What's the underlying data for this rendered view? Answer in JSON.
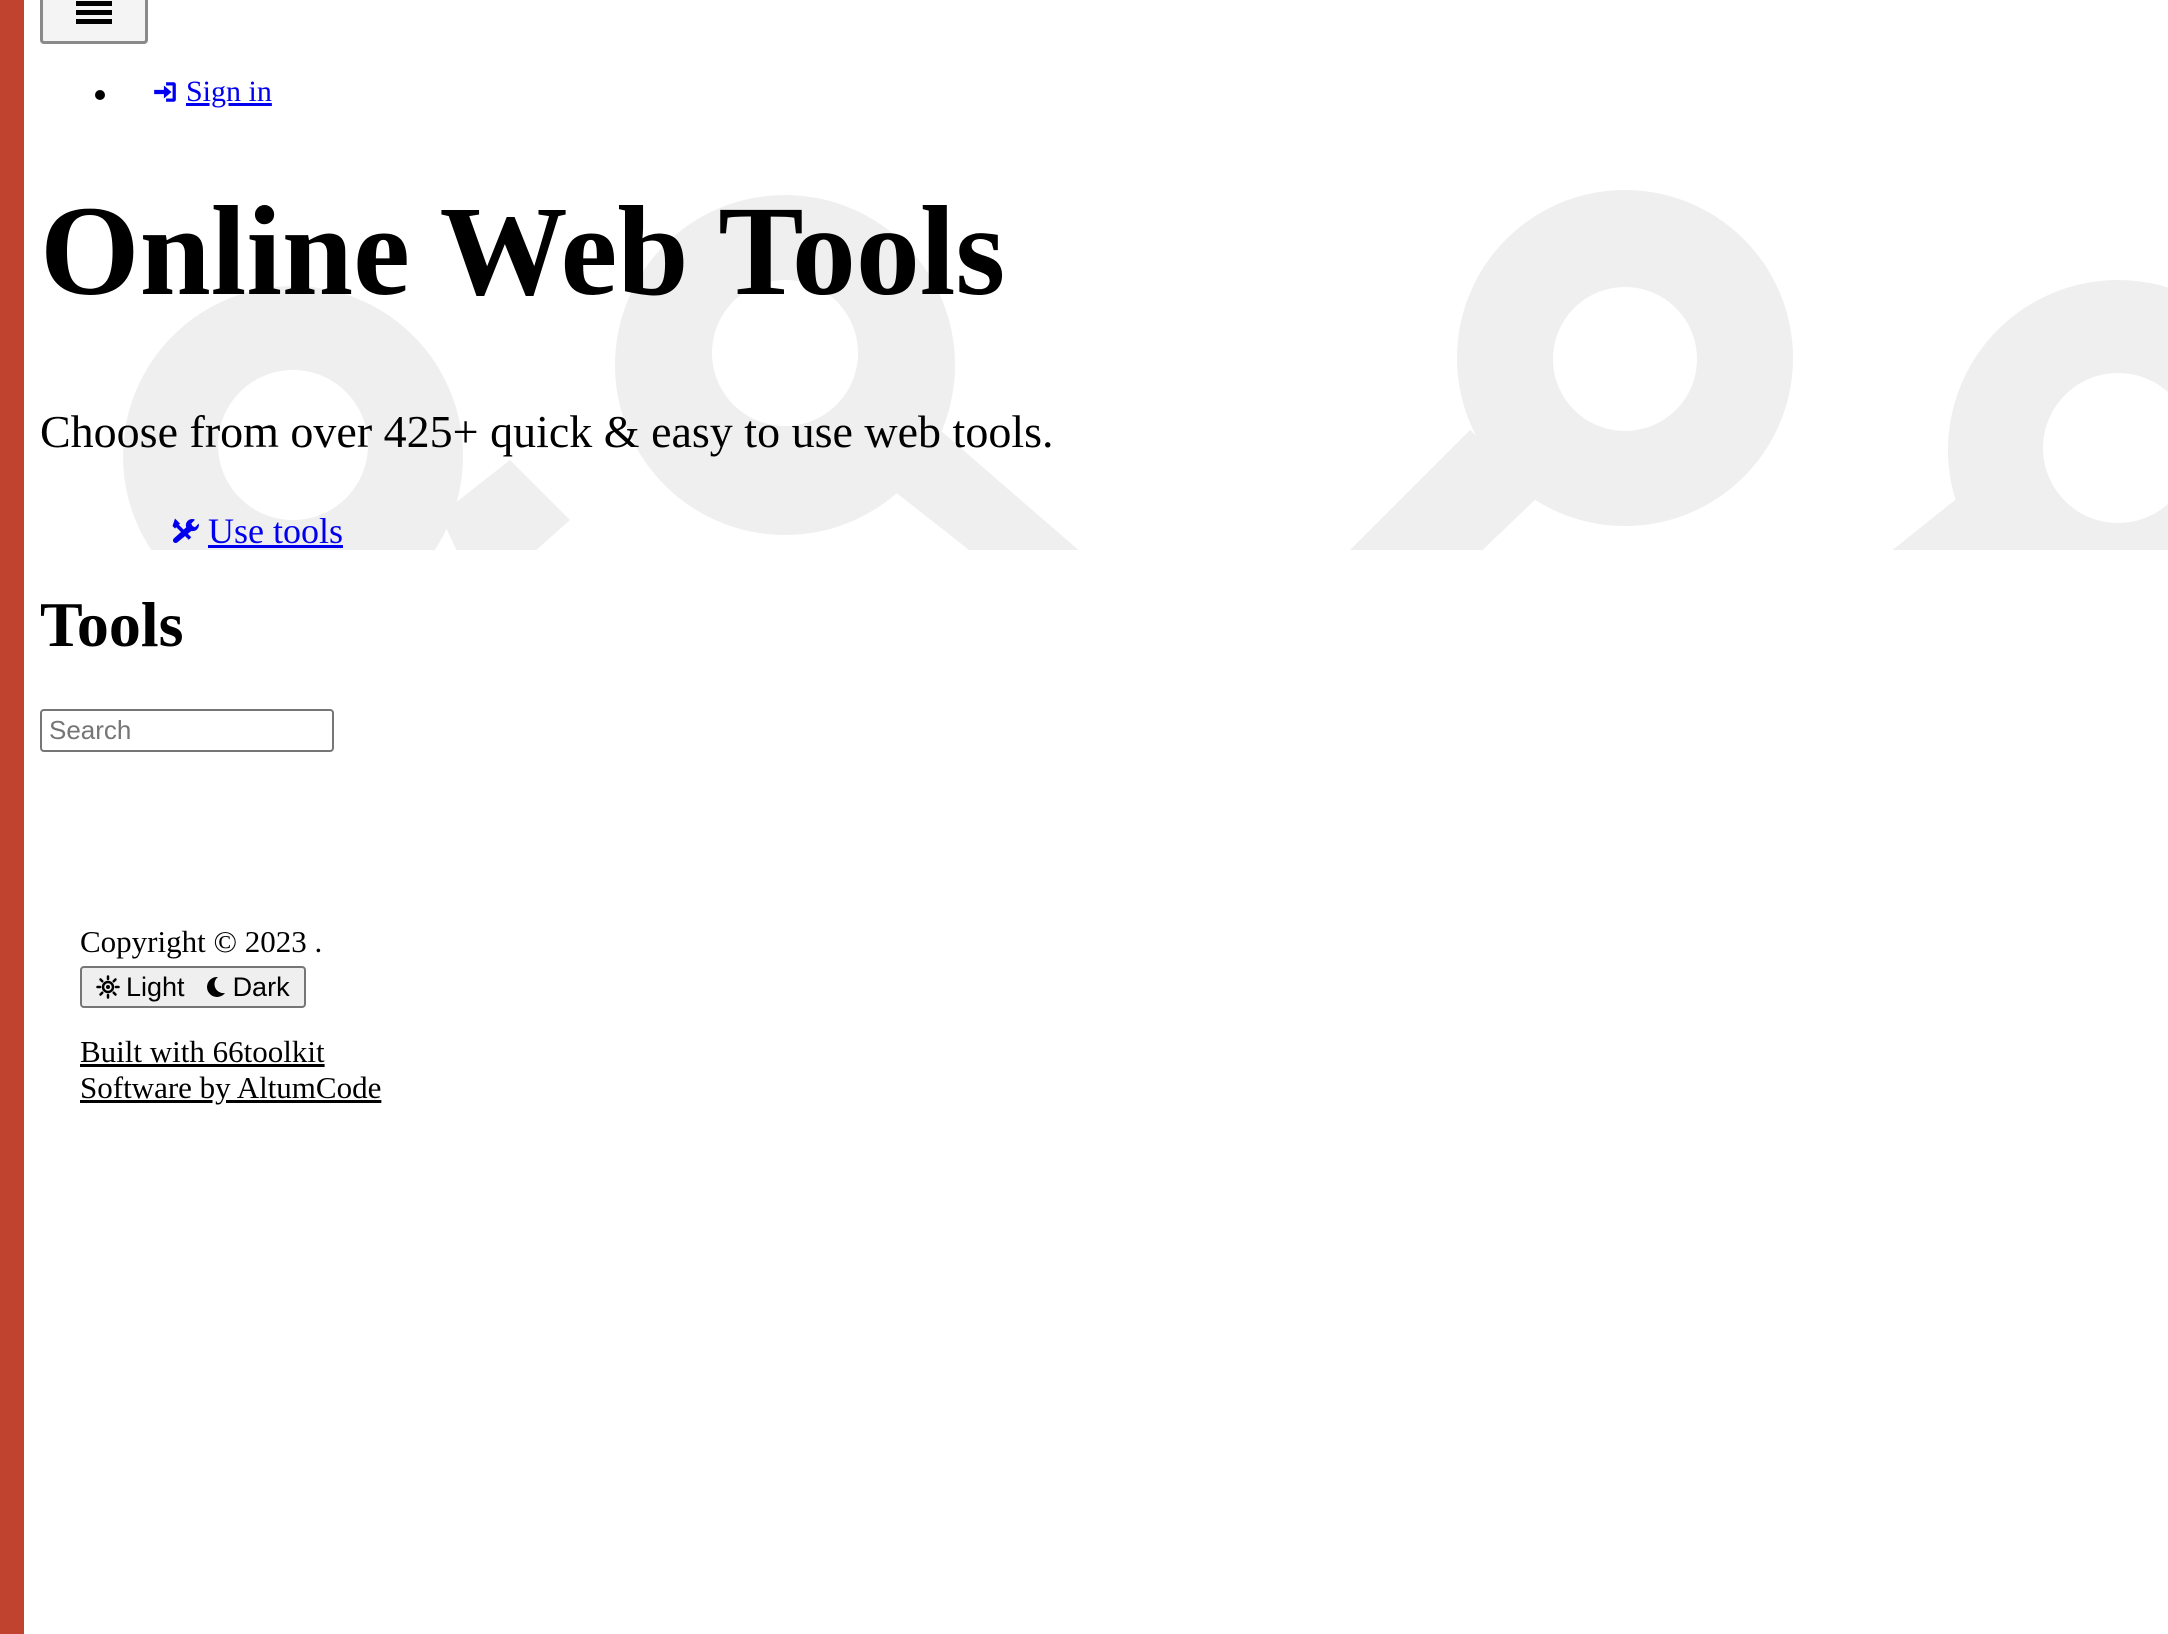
{
  "nav": {
    "sign_in_label": "Sign in",
    "sign_in_icon": "sign-in-icon",
    "menu_icon": "hamburger-icon"
  },
  "hero": {
    "title": "Online Web Tools",
    "subtitle": "Choose from over 425+ quick & easy to use web tools.",
    "cta_label": "Use tools",
    "cta_icon": "tools-icon",
    "background_icon": "search-icon"
  },
  "tools": {
    "heading": "Tools",
    "search_placeholder": "Search"
  },
  "footer": {
    "copyright": "Copyright © 2023 .",
    "theme_light_label": "Light",
    "theme_dark_label": "Dark",
    "theme_light_icon": "sun-icon",
    "theme_dark_icon": "moon-icon",
    "links": [
      "Built with 66toolkit",
      "Software by AltumCode"
    ]
  },
  "colors": {
    "accent_bar": "#c0432f",
    "link": "#0000ee",
    "hero_watermark": "#efefef"
  }
}
